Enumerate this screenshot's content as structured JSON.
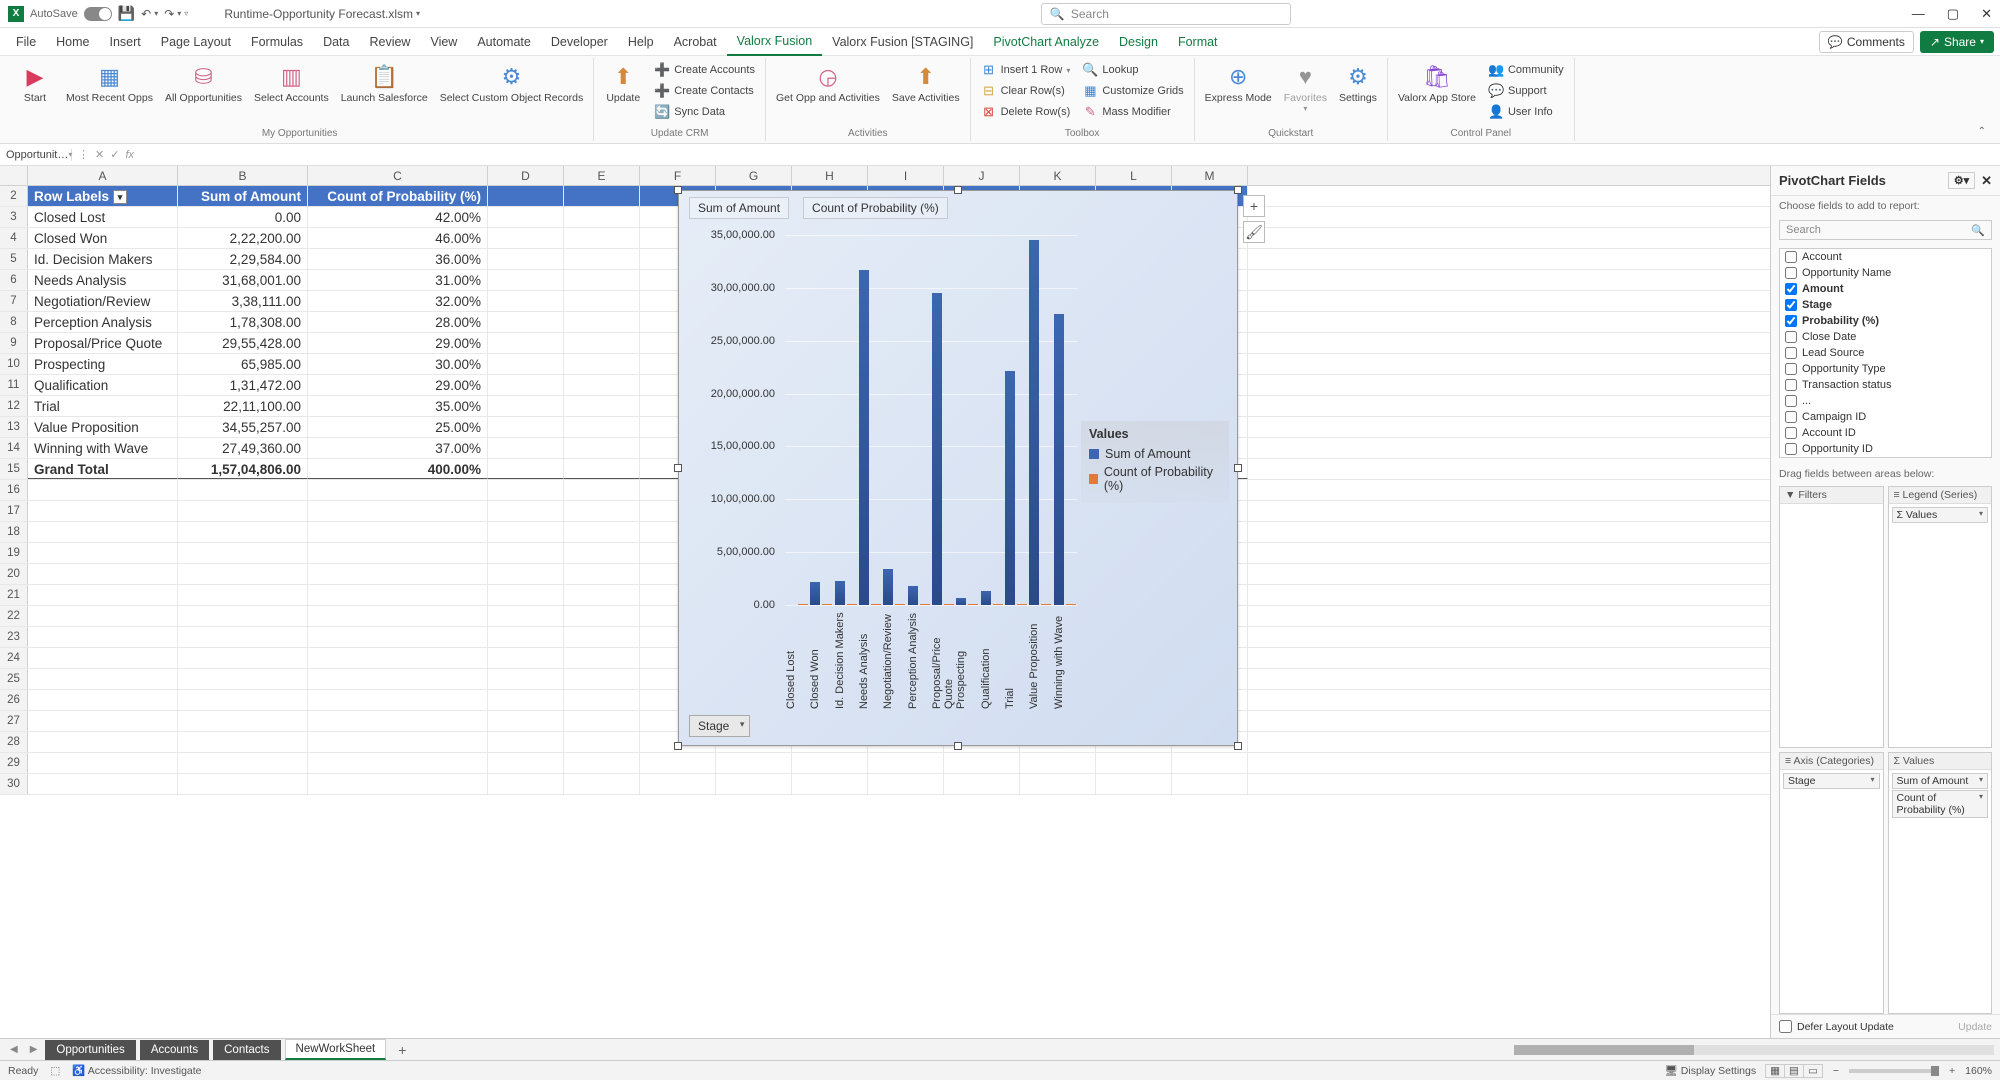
{
  "titlebar": {
    "autosave": "AutoSave",
    "autosave_state": "Off",
    "filename": "Runtime-Opportunity Forecast.xlsm",
    "search_placeholder": "Search"
  },
  "menubar": {
    "tabs": [
      "File",
      "Home",
      "Insert",
      "Page Layout",
      "Formulas",
      "Data",
      "Review",
      "View",
      "Automate",
      "Developer",
      "Help",
      "Acrobat",
      "Valorx Fusion",
      "Valorx Fusion [STAGING]",
      "PivotChart Analyze",
      "Design",
      "Format"
    ],
    "active": "Valorx Fusion",
    "comments": "Comments",
    "share": "Share"
  },
  "ribbon": {
    "groups": {
      "my_opps": {
        "label": "My Opportunities",
        "start": "Start",
        "recent": "Most Recent Opps",
        "all": "All Opportunities",
        "select_acc": "Select Accounts",
        "launch": "Launch Salesforce",
        "custom": "Select Custom Object Records"
      },
      "update_crm": {
        "label": "Update CRM",
        "update": "Update",
        "c_acc": "Create Accounts",
        "c_con": "Create Contacts",
        "sync": "Sync Data"
      },
      "activities": {
        "label": "Activities",
        "get": "Get Opp and Activities",
        "save": "Save Activities"
      },
      "toolbox": {
        "label": "Toolbox",
        "ins": "Insert 1 Row",
        "clr": "Clear Row(s)",
        "del": "Delete Row(s)",
        "look": "Lookup",
        "grid": "Customize Grids",
        "mass": "Mass Modifier"
      },
      "quickstart": {
        "label": "Quickstart",
        "express": "Express Mode",
        "fav": "Favorites",
        "settings": "Settings"
      },
      "control": {
        "label": "Control Panel",
        "store": "Valorx App Store",
        "comm": "Community",
        "supp": "Support",
        "user": "User Info"
      }
    }
  },
  "fxbar": {
    "namebox": "Opportunit…",
    "fx": "fx"
  },
  "columns": [
    "A",
    "B",
    "C",
    "D",
    "E",
    "F",
    "G",
    "H",
    "I",
    "J",
    "K",
    "L",
    "M"
  ],
  "table": {
    "headers": [
      "Row Labels",
      "Sum of Amount",
      "Count of Probability (%)"
    ],
    "rows": [
      {
        "label": "Closed Lost",
        "amount": "0.00",
        "prob": "42.00%"
      },
      {
        "label": "Closed Won",
        "amount": "2,22,200.00",
        "prob": "46.00%"
      },
      {
        "label": "Id. Decision Makers",
        "amount": "2,29,584.00",
        "prob": "36.00%"
      },
      {
        "label": "Needs Analysis",
        "amount": "31,68,001.00",
        "prob": "31.00%"
      },
      {
        "label": "Negotiation/Review",
        "amount": "3,38,111.00",
        "prob": "32.00%"
      },
      {
        "label": "Perception Analysis",
        "amount": "1,78,308.00",
        "prob": "28.00%"
      },
      {
        "label": "Proposal/Price Quote",
        "amount": "29,55,428.00",
        "prob": "29.00%"
      },
      {
        "label": "Prospecting",
        "amount": "65,985.00",
        "prob": "30.00%"
      },
      {
        "label": "Qualification",
        "amount": "1,31,472.00",
        "prob": "29.00%"
      },
      {
        "label": "Trial",
        "amount": "22,11,100.00",
        "prob": "35.00%"
      },
      {
        "label": "Value Proposition",
        "amount": "34,55,257.00",
        "prob": "25.00%"
      },
      {
        "label": "Winning with Wave",
        "amount": "27,49,360.00",
        "prob": "37.00%"
      }
    ],
    "total": {
      "label": "Grand Total",
      "amount": "1,57,04,806.00",
      "prob": "400.00%"
    }
  },
  "chart_data": {
    "type": "bar",
    "categories": [
      "Closed Lost",
      "Closed Won",
      "Id. Decision Makers",
      "Needs Analysis",
      "Negotiation/Review",
      "Perception Analysis",
      "Proposal/Price Quote",
      "Prospecting",
      "Qualification",
      "Trial",
      "Value Proposition",
      "Winning with Wave"
    ],
    "series": [
      {
        "name": "Sum of Amount",
        "color": "#3c66b0",
        "values": [
          0,
          222200,
          229584,
          3168001,
          338111,
          178308,
          2955428,
          65985,
          131472,
          2211100,
          3455257,
          2749360
        ]
      },
      {
        "name": "Count of Probability (%)",
        "color": "#e07a3a",
        "values": [
          42,
          46,
          36,
          31,
          32,
          28,
          29,
          30,
          29,
          35,
          25,
          37
        ]
      }
    ],
    "yticks": [
      "0.00",
      "5,00,000.00",
      "10,00,000.00",
      "15,00,000.00",
      "20,00,000.00",
      "25,00,000.00",
      "30,00,000.00",
      "35,00,000.00"
    ],
    "ymax": 3500000,
    "legend_top": [
      "Sum of Amount",
      "Count of Probability (%)"
    ],
    "legend_side_title": "Values",
    "axis_button": "Stage"
  },
  "pivot": {
    "title": "PivotChart Fields",
    "choose": "Choose fields to add to report:",
    "search": "Search",
    "fields": [
      {
        "name": "Account",
        "checked": false
      },
      {
        "name": "Opportunity Name",
        "checked": false
      },
      {
        "name": "Amount",
        "checked": true
      },
      {
        "name": "Stage",
        "checked": true
      },
      {
        "name": "Probability (%)",
        "checked": true
      },
      {
        "name": "Close Date",
        "checked": false
      },
      {
        "name": "Lead Source",
        "checked": false
      },
      {
        "name": "Opportunity Type",
        "checked": false
      },
      {
        "name": "Transaction status",
        "checked": false
      },
      {
        "name": "...",
        "checked": false
      },
      {
        "name": "Campaign ID",
        "checked": false
      },
      {
        "name": "Account ID",
        "checked": false
      },
      {
        "name": "Opportunity ID",
        "checked": false
      }
    ],
    "drag_label": "Drag fields between areas below:",
    "areas": {
      "filters": "Filters",
      "legend": "Legend (Series)",
      "legend_items": [
        "Σ Values"
      ],
      "axis": "Axis (Categories)",
      "axis_items": [
        "Stage"
      ],
      "values": "Σ Values",
      "values_items": [
        "Sum of Amount",
        "Count of Probability (%)"
      ]
    },
    "defer": "Defer Layout Update",
    "update": "Update"
  },
  "sheets": {
    "tabs": [
      "Opportunities",
      "Accounts",
      "Contacts",
      "NewWorkSheet"
    ],
    "active": "NewWorkSheet"
  },
  "status": {
    "ready": "Ready",
    "access": "Accessibility: Investigate",
    "display": "Display Settings",
    "zoom": "160%"
  }
}
